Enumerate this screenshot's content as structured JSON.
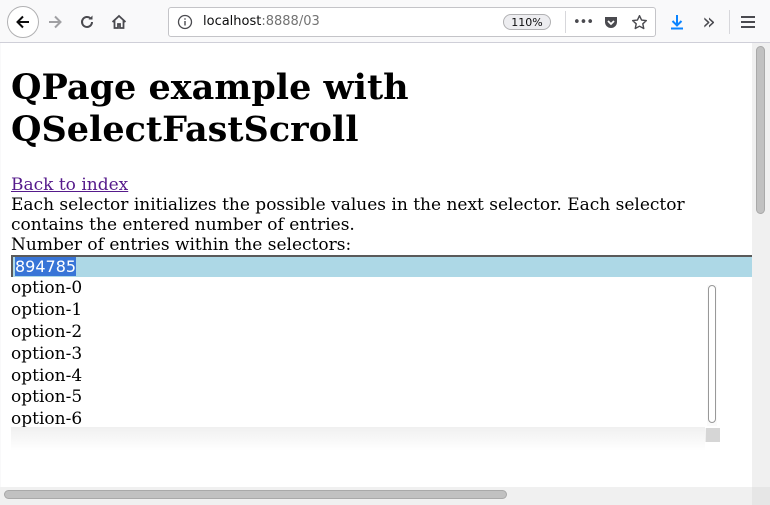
{
  "browser": {
    "url_host": "localhost",
    "url_path": ":8888/03",
    "zoom": "110%",
    "more_label": "•••",
    "overflow_label": "»",
    "icons": [
      "back-icon",
      "forward-icon",
      "reload-icon",
      "home-icon",
      "info-icon",
      "page-actions-icon",
      "pocket-icon",
      "bookmark-star-icon",
      "download-icon",
      "overflow-icon",
      "menu-icon"
    ]
  },
  "page": {
    "title_line1": "QPage example with",
    "title_line2": "QSelectFastScroll",
    "back_link": "Back to index",
    "description": "Each selector initializes the possible values in the next selector. Each selector contains the entered number of entries.",
    "entries_label": "Number of entries within the selectors:",
    "entries_value": "894785",
    "options": [
      "option-0",
      "option-1",
      "option-2",
      "option-3",
      "option-4",
      "option-5",
      "option-6"
    ]
  }
}
